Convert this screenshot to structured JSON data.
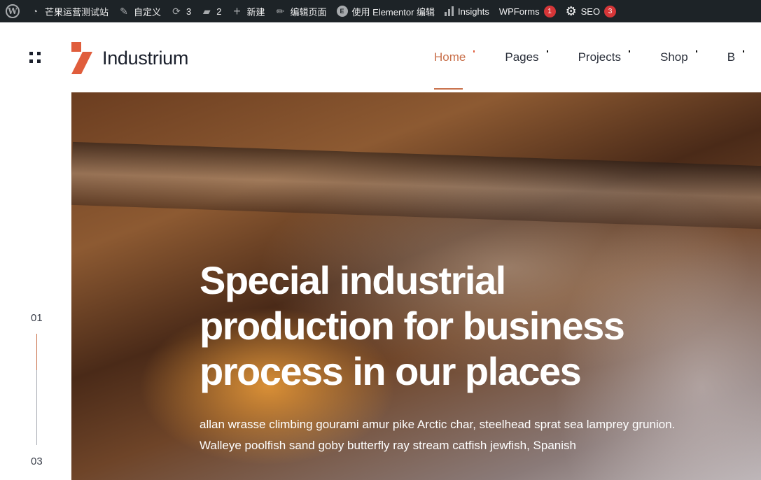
{
  "adminbar": {
    "site_name": "芒果运营测试站",
    "customize": "自定义",
    "updates_count": "3",
    "comments_count": "2",
    "new": "新建",
    "edit_page": "编辑页面",
    "elementor": "使用 Elementor 编辑",
    "insights": "Insights",
    "wpforms": "WPForms",
    "wpforms_badge": "1",
    "seo": "SEO",
    "seo_badge": "3"
  },
  "header": {
    "logo_text": "Industrium",
    "brand_color": "#e05d3c",
    "nav": [
      {
        "label": "Home",
        "active": true
      },
      {
        "label": "Pages"
      },
      {
        "label": "Projects"
      },
      {
        "label": "Shop"
      },
      {
        "label": "B"
      }
    ]
  },
  "hero": {
    "title_line1": "Special industrial",
    "title_line2a": "production ",
    "title_highlight": "for business",
    "title_line3": "process in our places",
    "subtitle": "allan wrasse climbing gourami amur pike Arctic char, steelhead sprat sea lamprey grunion. Walleye poolfish sand goby butterfly ray stream catfish jewfish, Spanish"
  },
  "slider": {
    "current": "01",
    "total": "03",
    "progress": 0.33
  }
}
